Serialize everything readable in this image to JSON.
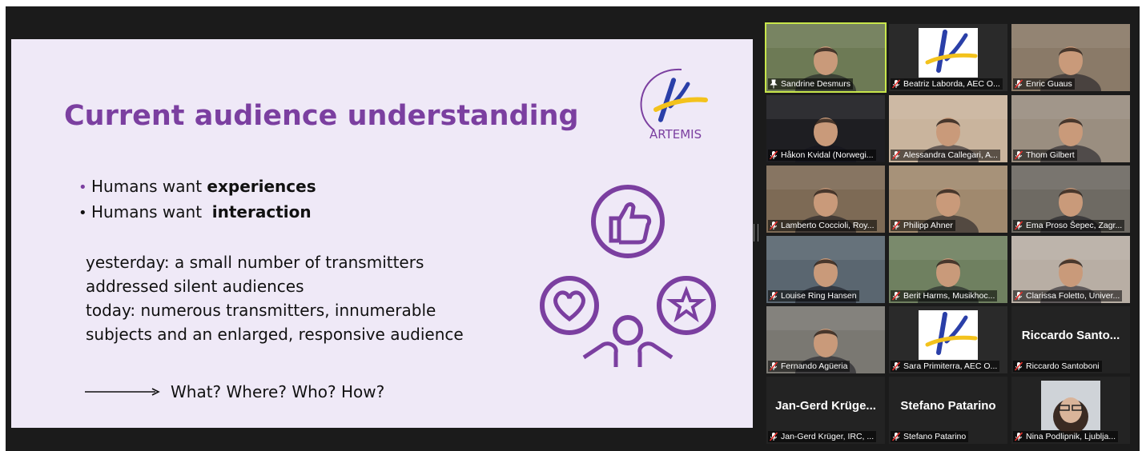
{
  "slide": {
    "title": "Current audience understanding",
    "logo_text": "ARTEMIS",
    "bullets": [
      {
        "prefix": "Humans want ",
        "bold": "experiences"
      },
      {
        "prefix": "Humans want  ",
        "bold": "interaction"
      }
    ],
    "paragraph": [
      "yesterday: a small number of transmitters",
      "addressed silent audiences",
      "today: numerous transmitters, innumerable",
      "subjects and an enlarged, responsive audience"
    ],
    "arrow_text": "What? Where? Who? How?",
    "colors": {
      "accent": "#7b3fa0",
      "background": "#efe9f7",
      "logo_yellow": "#f3c21c",
      "logo_blue": "#2a3fa8"
    }
  },
  "participants": [
    {
      "name": "Sandrine Desmurs",
      "pinned": true,
      "muted": false,
      "active": true,
      "tile": "video",
      "bg": "#6d7a55"
    },
    {
      "name": "Beatriz Laborda, AEC O...",
      "muted": true,
      "tile": "logo",
      "bg": "#2a2a2a"
    },
    {
      "name": "Enric Guaus",
      "muted": true,
      "tile": "video",
      "bg": "#8a7a68"
    },
    {
      "name": "Håkon Kvidal (Norwegi...",
      "muted": true,
      "tile": "video",
      "bg": "#1e1e22"
    },
    {
      "name": "Alessandra Callegari, A...",
      "muted": true,
      "tile": "video",
      "bg": "#c9b49d"
    },
    {
      "name": "Thom Gilbert",
      "muted": true,
      "tile": "video",
      "bg": "#9a8e80"
    },
    {
      "name": "Lamberto Coccioli, Roy...",
      "muted": true,
      "tile": "video",
      "bg": "#7d6a55"
    },
    {
      "name": "Philipp Ahner",
      "muted": true,
      "tile": "video",
      "bg": "#a0896e"
    },
    {
      "name": "Ema Proso Šepec, Zagr...",
      "muted": true,
      "tile": "video",
      "bg": "#6e6a63"
    },
    {
      "name": "Louise Ring Hansen",
      "muted": true,
      "tile": "video",
      "bg": "#5a6670"
    },
    {
      "name": "Berit Harms, Musikhoc...",
      "muted": true,
      "tile": "video",
      "bg": "#6f8060"
    },
    {
      "name": "Clarissa Foletto, Univer...",
      "muted": true,
      "tile": "video",
      "bg": "#b8aea4"
    },
    {
      "name": "Fernando Agüeria",
      "muted": true,
      "tile": "video",
      "bg": "#7a7872"
    },
    {
      "name": "Sara Primiterra, AEC O...",
      "muted": true,
      "tile": "logo",
      "bg": "#2a2a2a"
    },
    {
      "name": "Riccardo Santoboni",
      "muted": true,
      "tile": "text",
      "big": "Riccardo Santo...",
      "bg": "#232323"
    },
    {
      "name": "Jan-Gerd Krüger, IRC, ...",
      "muted": true,
      "tile": "text",
      "big": "Jan-Gerd Krüge...",
      "bg": "#232323"
    },
    {
      "name": "Stefano Patarino",
      "muted": true,
      "tile": "text",
      "big": "Stefano Patarino",
      "bg": "#232323"
    },
    {
      "name": "Nina Podlipnik, Ljublja...",
      "muted": true,
      "tile": "photo",
      "bg": "#232323"
    }
  ]
}
